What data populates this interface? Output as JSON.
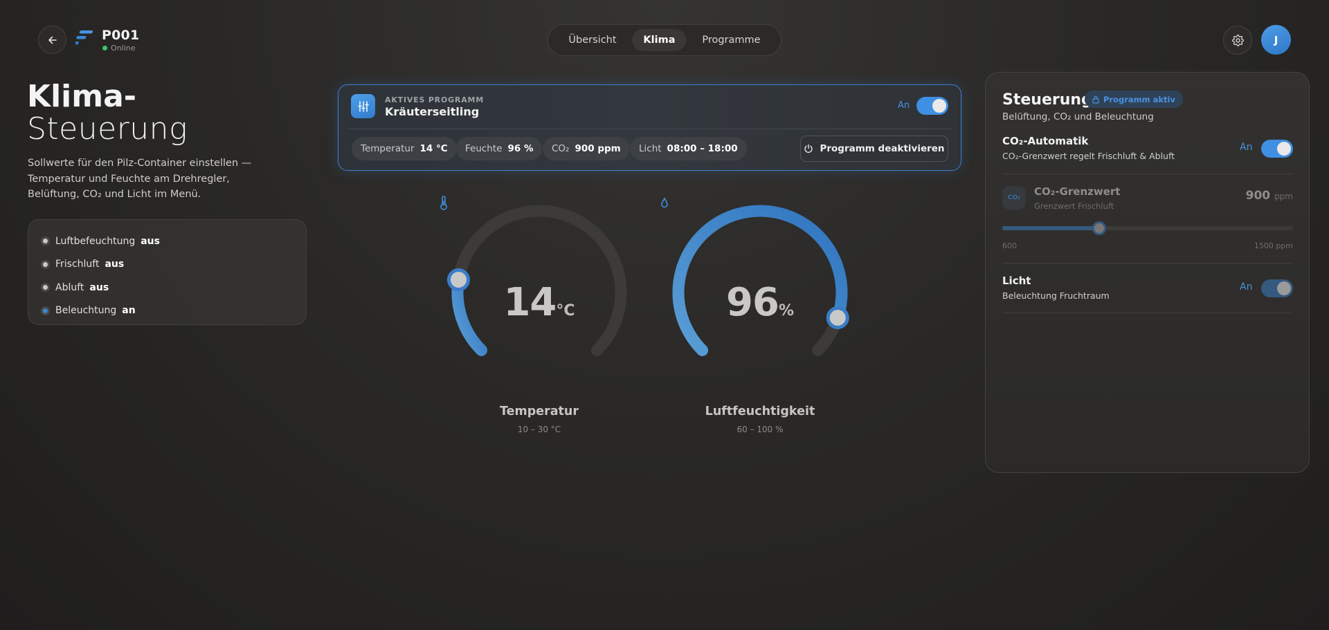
{
  "header": {
    "device_name": "P001",
    "device_status": "Online",
    "tabs": [
      {
        "label": "Übersicht",
        "active": false
      },
      {
        "label": "Klima",
        "active": true
      },
      {
        "label": "Programme",
        "active": false
      }
    ],
    "avatar_initial": "J",
    "icons": {
      "back": "arrow-left-icon",
      "logo": "brand-logo-icon",
      "settings": "gear-icon"
    }
  },
  "left": {
    "title_bold": "Klima-",
    "title_light": "Steuerung",
    "description": "Sollwerte für den Pilz-Container einstellen — Temperatur und Feuchte am Drehregler, Belüftung, CO₂ und Licht im Menü.",
    "status_items": [
      {
        "label": "Luftbefeuchtung",
        "state": "aus",
        "on": false
      },
      {
        "label": "Frischluft",
        "state": "aus",
        "on": false
      },
      {
        "label": "Abluft",
        "state": "aus",
        "on": false
      },
      {
        "label": "Beleuchtung",
        "state": "an",
        "on": true
      }
    ]
  },
  "program": {
    "label": "AKTIVES PROGRAMM",
    "name": "Kräuterseitling",
    "toggle_label": "An",
    "toggle_on": true,
    "chips": [
      {
        "label": "Temperatur",
        "value": "14 °C"
      },
      {
        "label": "Feuchte",
        "value": "96 %"
      },
      {
        "label": "CO₂",
        "value": "900 ppm"
      },
      {
        "label": "Licht",
        "value": "08:00 – 18:00"
      }
    ],
    "deactivate_label": "Programm deaktivieren"
  },
  "gauges": {
    "temperature": {
      "value": "14",
      "unit": "°C",
      "title": "Temperatur",
      "range": "10 – 30 °C",
      "fill_fraction": 0.2,
      "icon": "thermometer-icon"
    },
    "humidity": {
      "value": "96",
      "unit": "%",
      "title": "Luftfeuchtigkeit",
      "range": "60 – 100 %",
      "fill_fraction": 0.9,
      "icon": "droplet-icon"
    }
  },
  "panel": {
    "title": "Steuerung",
    "badge": "Programm aktiv",
    "subtitle": "Belüftung, CO₂ und Beleuchtung",
    "co2_auto": {
      "title": "CO₂-Automatik",
      "subtitle": "CO₂-Grenzwert regelt Frischluft & Abluft",
      "state_label": "An",
      "on": true
    },
    "co2_limit": {
      "icon_text": "CO₂",
      "title": "CO₂-Grenzwert",
      "subtitle": "Grenzwert Frischluft",
      "value": "900",
      "unit": "ppm",
      "min_label": "600",
      "max_label": "1500 ppm",
      "slider_fraction": 0.333
    },
    "light": {
      "title": "Licht",
      "subtitle": "Beleuchtung Fruchtraum",
      "state_label": "An",
      "on": true
    },
    "colors": {
      "accent": "#3f8fe2",
      "accent_text": "#4a92e0"
    }
  }
}
